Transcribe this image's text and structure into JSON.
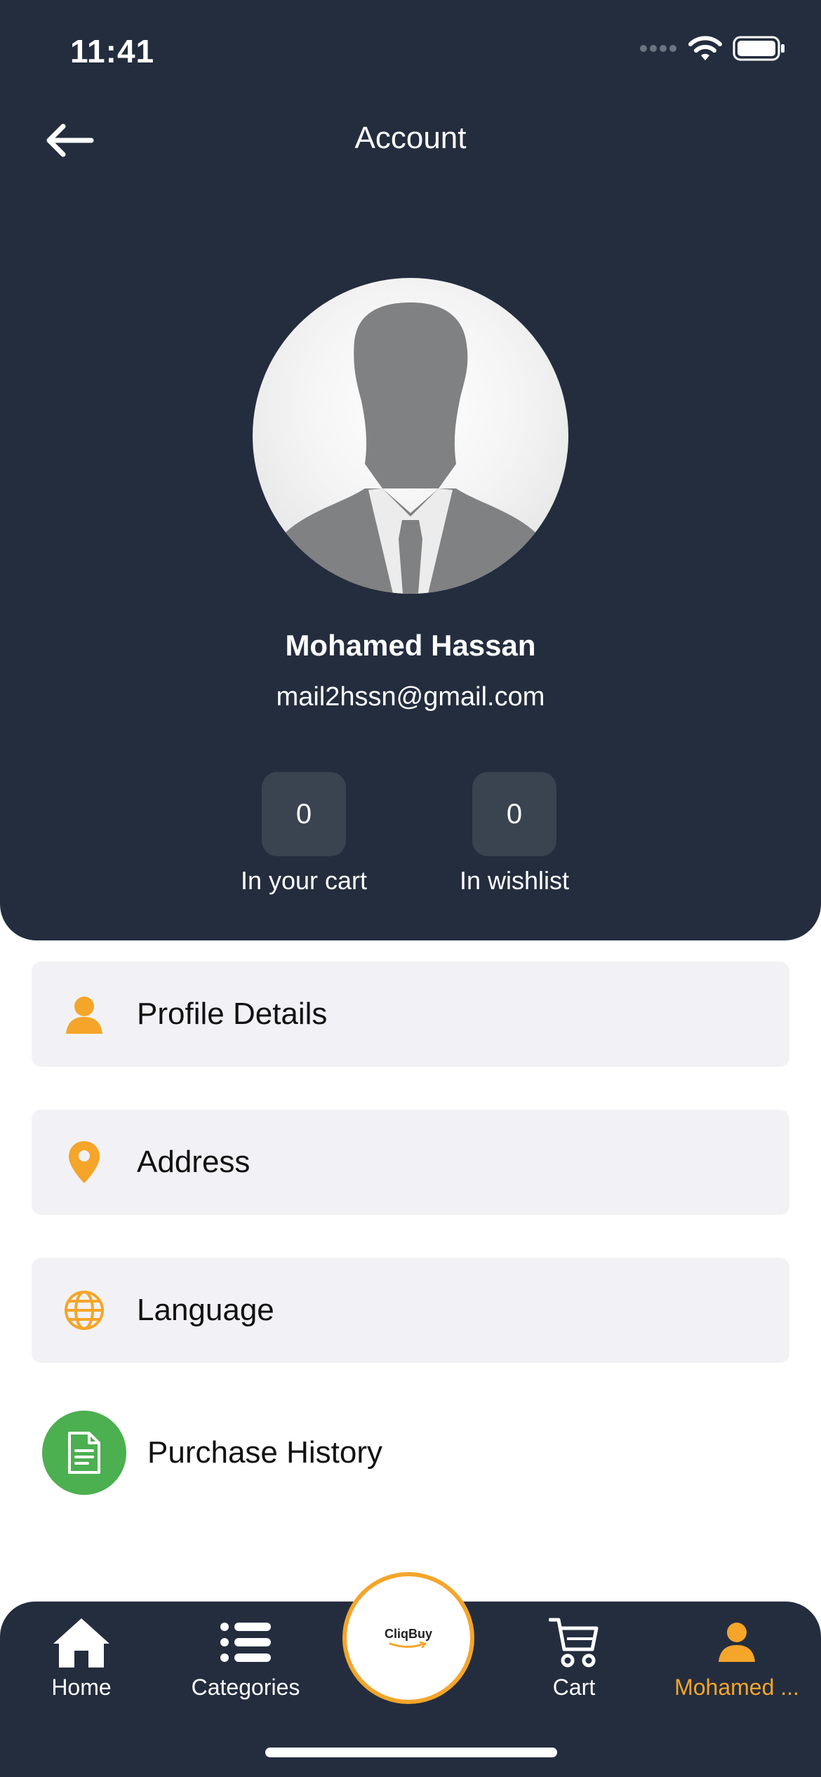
{
  "status_bar": {
    "time": "11:41"
  },
  "header": {
    "title": "Account"
  },
  "profile": {
    "name": "Mohamed Hassan",
    "email": "mail2hssn@gmail.com"
  },
  "stats": [
    {
      "value": "0",
      "label": "In your cart"
    },
    {
      "value": "0",
      "label": "In wishlist"
    }
  ],
  "menu": {
    "profile_details": "Profile Details",
    "address": "Address",
    "language": "Language",
    "purchase_history": "Purchase History"
  },
  "tabbar": {
    "home": "Home",
    "categories": "Categories",
    "logo": "CliqBuy",
    "cart": "Cart",
    "account": "Mohamed ..."
  },
  "colors": {
    "header_bg": "#232d3e",
    "accent": "#f4a52a",
    "purchase_green": "#4caf50"
  },
  "icons": {
    "back": "arrow-left-icon",
    "profile": "person-icon",
    "address": "location-pin-icon",
    "language": "globe-icon",
    "purchase": "document-icon",
    "home": "home-icon",
    "categories": "list-icon",
    "cart": "cart-icon",
    "account": "person-icon"
  }
}
